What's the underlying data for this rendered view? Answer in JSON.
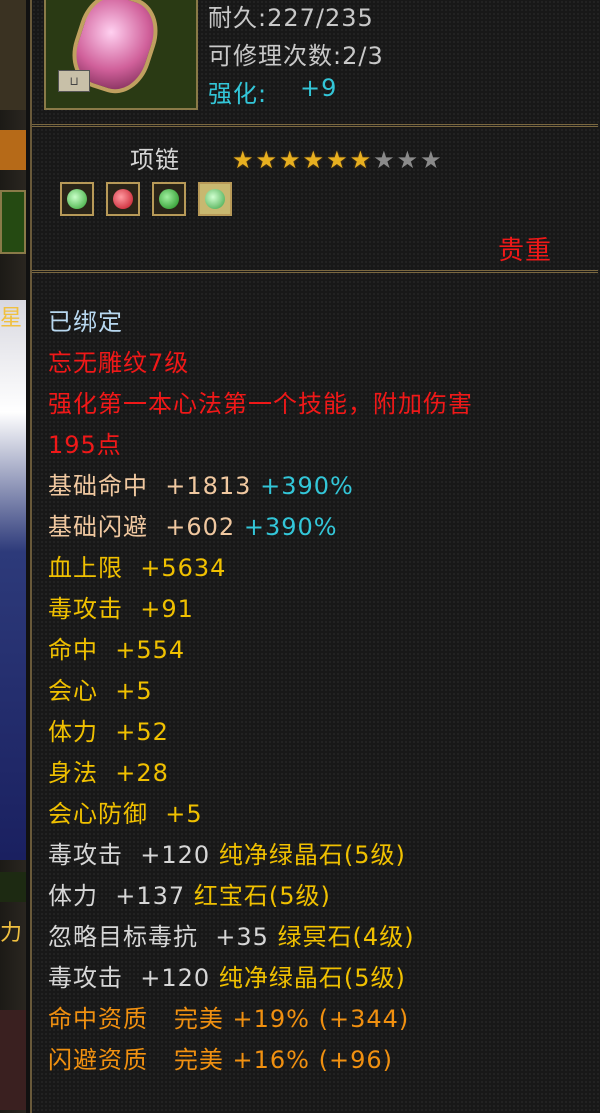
{
  "item": {
    "durability_label": "耐久:227/235",
    "repair_label": "可修理次数:2/3",
    "enhance_label": "强化:",
    "enhance_value": "+9",
    "type": "项链",
    "stars_filled": 6,
    "stars_total": 9,
    "rarity": "贵重",
    "sockets": [
      "green-gem",
      "red-gem",
      "green-gem",
      "green-gem"
    ]
  },
  "stats": {
    "bound": "已绑定",
    "engraving": "忘无雕纹7级",
    "engraving_desc_1": "强化第一本心法第一个技能，附加伤害",
    "engraving_desc_2": "195点",
    "base_hit": {
      "label": "基础命中",
      "value": "+1813",
      "bonus": "+390%"
    },
    "base_dodge": {
      "label": "基础闪避",
      "value": "+602",
      "bonus": "+390%"
    },
    "attrs": [
      {
        "label": "血上限",
        "value": "+5634"
      },
      {
        "label": "毒攻击",
        "value": "+91"
      },
      {
        "label": "命中",
        "value": "+554"
      },
      {
        "label": "会心",
        "value": "+5"
      },
      {
        "label": "体力",
        "value": "+52"
      },
      {
        "label": "身法",
        "value": "+28"
      },
      {
        "label": "会心防御",
        "value": "+5"
      }
    ],
    "gems": [
      {
        "label": "毒攻击",
        "value": "+120",
        "gem": "纯净绿晶石(5级)"
      },
      {
        "label": "体力",
        "value": "+137",
        "gem": "红宝石(5级)"
      },
      {
        "label": "忽略目标毒抗",
        "value": "+35",
        "gem": "绿冥石(4级)"
      },
      {
        "label": "毒攻击",
        "value": "+120",
        "gem": "纯净绿晶石(5级)"
      }
    ],
    "aptitudes": [
      {
        "label": "命中资质",
        "grade": "完美",
        "pct": "+19%",
        "bonus": "(+344)"
      },
      {
        "label": "闪避资质",
        "grade": "完美",
        "pct": "+16%",
        "bonus": "(+96)"
      }
    ]
  },
  "left_strip": {
    "glyph_1": "星",
    "glyph_2": "力"
  },
  "colors": {
    "red": "#f01818",
    "cyan": "#33c6d8",
    "orange": "#f09010",
    "yellow": "#f0c000",
    "gold_star": "#e8b020"
  }
}
